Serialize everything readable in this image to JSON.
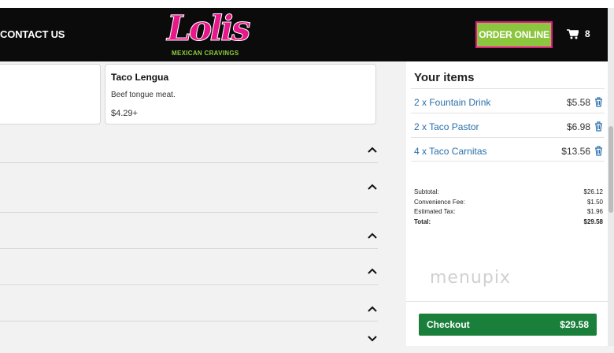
{
  "header": {
    "contact_label": "CONTACT US",
    "logo_text": "Lolis",
    "logo_subtitle": "MEXICAN CRAVINGS",
    "order_online_label": "ORDER ONLINE",
    "cart_count": "8",
    "colors": {
      "background": "#0b0b0b",
      "brand_pink": "#e8178a",
      "brand_green": "#8cc63f"
    }
  },
  "menu": {
    "card": {
      "name": "Taco Lengua",
      "description": "Beef tongue meat.",
      "price": "$4.29+"
    },
    "sections_collapsed_icons": [
      "chevron-up-icon",
      "chevron-up-icon",
      "chevron-up-icon",
      "chevron-up-icon",
      "chevron-up-icon",
      "chevron-down-icon"
    ]
  },
  "cart": {
    "title": "Your items",
    "items": [
      {
        "label": "2 x Fountain Drink",
        "price": "$5.58"
      },
      {
        "label": "2 x Taco Pastor",
        "price": "$6.98"
      },
      {
        "label": "4 x Taco Carnitas",
        "price": "$13.56"
      }
    ],
    "totals": {
      "subtotal_label": "Subtotal:",
      "subtotal": "$26.12",
      "fee_label": "Convenience Fee:",
      "fee": "$1.50",
      "tax_label": "Estimated Tax:",
      "tax": "$1.96",
      "total_label": "Total:",
      "total": "$29.58"
    },
    "watermark": "menupix",
    "checkout_label": "Checkout",
    "checkout_amount": "$29.58",
    "colors": {
      "link": "#2a6fa8",
      "checkout": "#1a7f3a"
    }
  }
}
